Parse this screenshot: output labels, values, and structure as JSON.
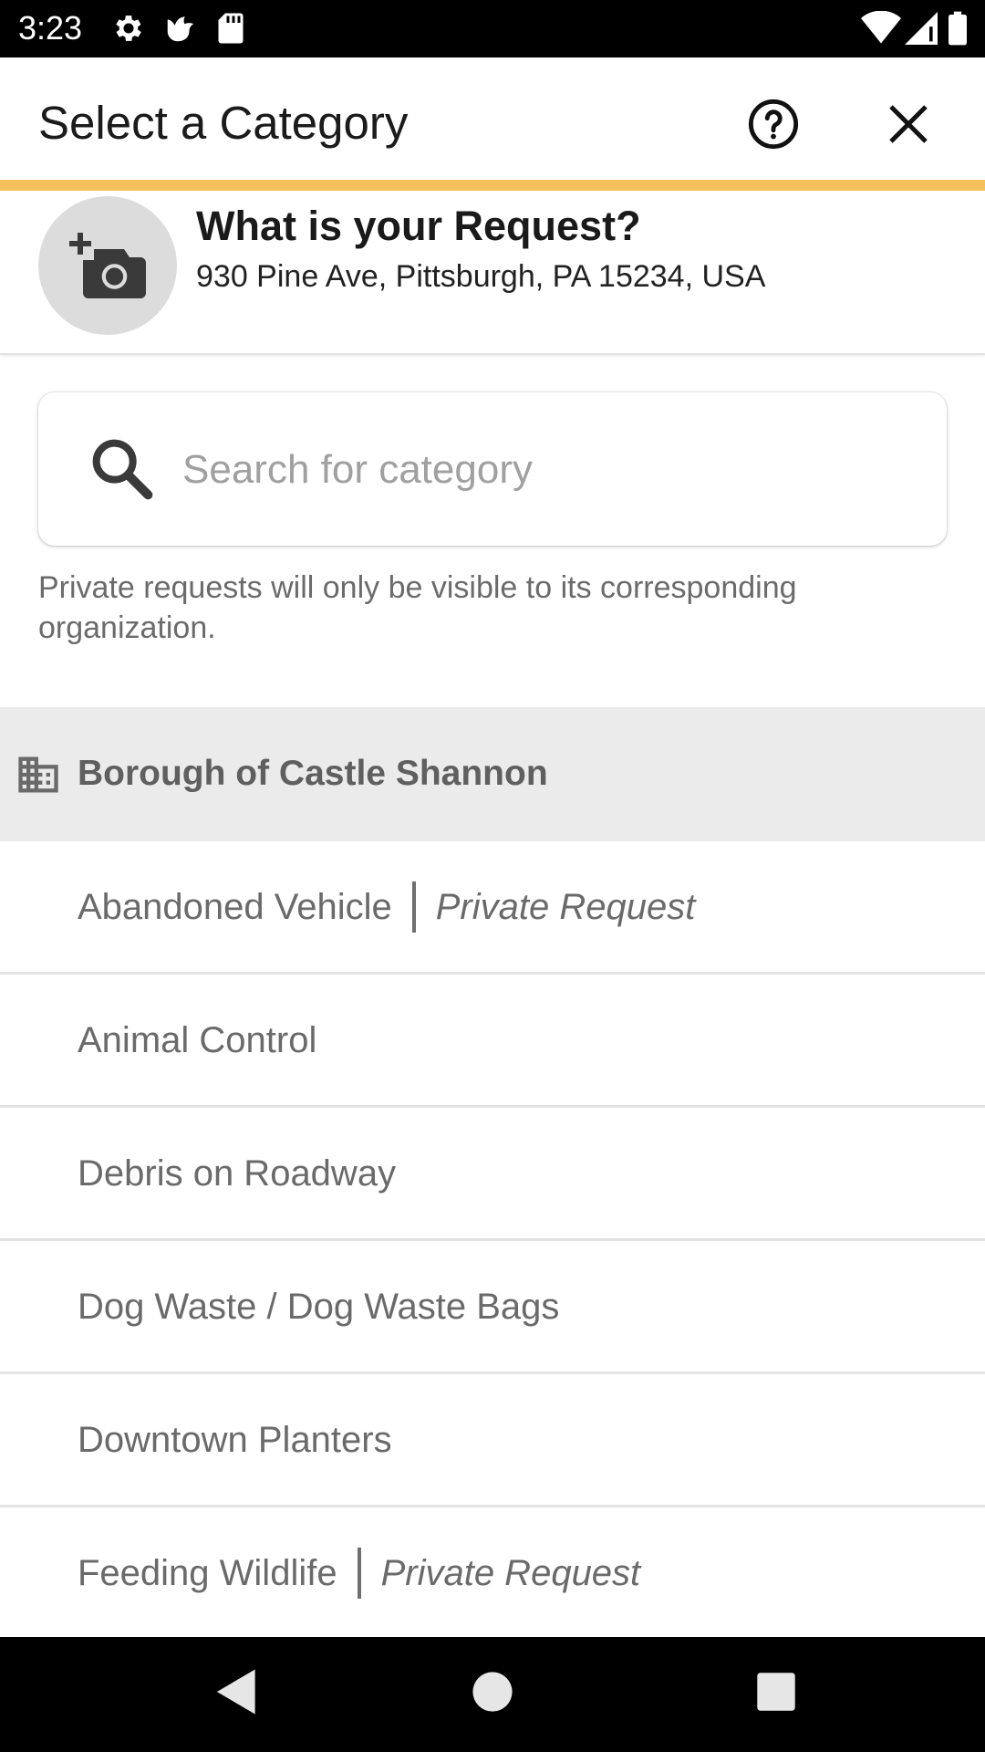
{
  "status_bar": {
    "time": "3:23",
    "left_icons": [
      "gear-icon",
      "bird-icon",
      "sd-card-icon"
    ],
    "right_icons": [
      "wifi-icon",
      "signal-icon",
      "battery-icon"
    ]
  },
  "header": {
    "title": "Select a Category",
    "help_icon": "help-circle-icon",
    "close_icon": "close-icon",
    "accent_color": "#F5C15C"
  },
  "request": {
    "heading": "What is your Request?",
    "address": "930 Pine Ave, Pittsburgh, PA 15234, USA",
    "photo_icon": "add-photo-icon"
  },
  "search": {
    "placeholder": "Search for category",
    "value": ""
  },
  "private_note": "Private requests will only be visible to its corresponding organization.",
  "organization": {
    "name": "Borough of Castle Shannon",
    "icon": "building-icon"
  },
  "categories": [
    {
      "name": "Abandoned Vehicle",
      "tag": "Private Request"
    },
    {
      "name": "Animal Control",
      "tag": ""
    },
    {
      "name": "Debris on Roadway",
      "tag": ""
    },
    {
      "name": "Dog Waste / Dog Waste Bags",
      "tag": ""
    },
    {
      "name": "Downtown Planters",
      "tag": ""
    },
    {
      "name": "Feeding Wildlife",
      "tag": "Private Request"
    }
  ],
  "nav_bar": {
    "icons": [
      "back-icon",
      "home-icon",
      "recents-icon"
    ]
  }
}
